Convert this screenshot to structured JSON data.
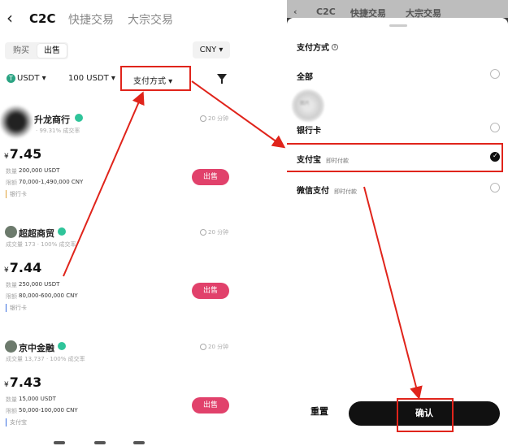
{
  "left": {
    "nav": {
      "back": "‹",
      "c2c": "C2C",
      "quick": "快捷交易",
      "bulk": "大宗交易"
    },
    "segment": {
      "buy": "购买",
      "sell": "出售"
    },
    "currency": "CNY ▾",
    "filters": {
      "coin": "USDT ▾",
      "coin_icon": "T",
      "amount": "100 USDT ▾",
      "payment": "支付方式 ▾"
    },
    "listings": [
      {
        "name": "升龙商行",
        "stats": "· 99.31% 成交率",
        "time": "20 分钟",
        "price": "7.45",
        "qty_label": "数量",
        "qty": "200,000 USDT",
        "lim_label": "限额",
        "limit": "70,000-1,490,000 CNY",
        "method": "银行卡",
        "action": "出售"
      },
      {
        "name": "超超商贸",
        "stats": "成交量 173 · 100% 成交率",
        "time": "20 分钟",
        "price": "7.44",
        "qty_label": "数量",
        "qty": "250,000 USDT",
        "lim_label": "限额",
        "limit": "80,000-600,000 CNY",
        "method": "银行卡",
        "action": "出售"
      },
      {
        "name": "京中金融",
        "stats": "成交量 13,737 · 100% 成交率",
        "time": "20 分钟",
        "price": "7.43",
        "qty_label": "数量",
        "qty": "15,000 USDT",
        "lim_label": "限额",
        "limit": "50,000-100,000 CNY",
        "method": "支付宝",
        "action": "出售"
      }
    ]
  },
  "right": {
    "top": {
      "back": "‹",
      "c2c": "C2C",
      "quick": "快捷交易",
      "bulk": "大宗交易"
    },
    "title": "支付方式",
    "info_icon": "i",
    "blur_text": "图片",
    "options": [
      {
        "label": "全部",
        "sub": "",
        "checked": false
      },
      {
        "label": "银行卡",
        "sub": "",
        "checked": false
      },
      {
        "label": "支付宝",
        "sub": "即时付款",
        "checked": true
      },
      {
        "label": "微信支付",
        "sub": "即时付款",
        "checked": false
      }
    ],
    "reset": "重置",
    "confirm": "确认"
  },
  "colors": {
    "accent": "#e1416b",
    "highlight": "#e0241b",
    "verify": "#2fc49a"
  }
}
